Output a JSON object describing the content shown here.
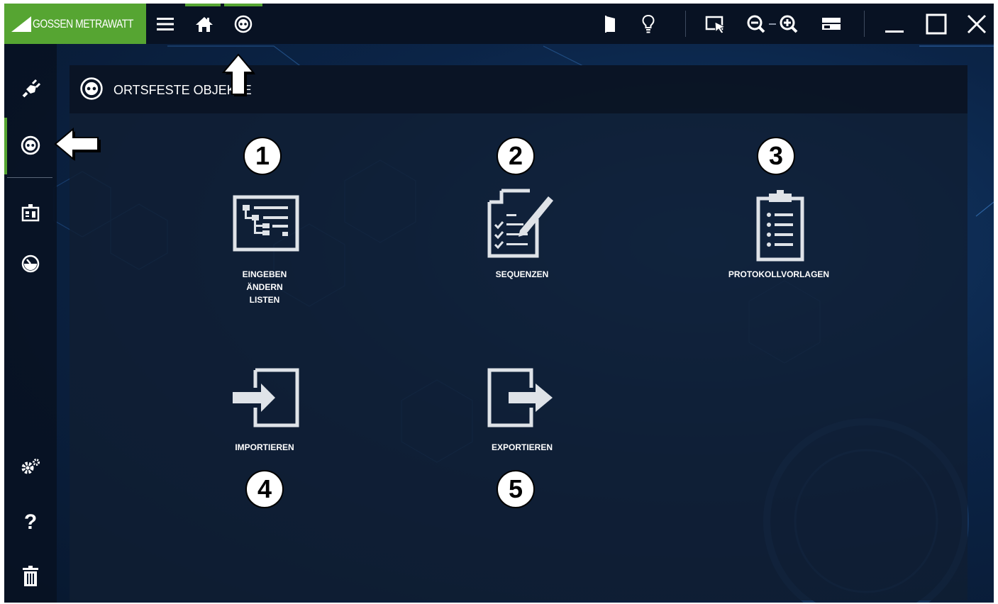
{
  "app": {
    "brand": "GOSSEN METRAWATT",
    "accent_color": "#56a532"
  },
  "titlebar": {
    "left_icons": [
      "menu-icon",
      "home-icon",
      "socket-icon"
    ],
    "right_icons": [
      "door-icon",
      "lightbulb-icon",
      "select-cursor-icon",
      "zoom-out-icon",
      "zoom-in-icon",
      "layout-icon",
      "minimize-icon",
      "maximize-icon",
      "close-icon"
    ]
  },
  "sidebar": {
    "items": [
      "plug-icon",
      "socket-icon",
      "device-id-icon",
      "gauge-icon",
      "settings-icon",
      "help-icon",
      "trash-icon"
    ],
    "help_glyph": "?"
  },
  "panel": {
    "title": "ORTSFESTE OBJEKTE",
    "tiles": [
      {
        "number": "1",
        "label": "EINGEBEN\nÄNDERN\nLISTEN",
        "icon": "tree-list-icon"
      },
      {
        "number": "2",
        "label": "SEQUENZEN",
        "icon": "checklist-edit-icon"
      },
      {
        "number": "3",
        "label": "PROTOKOLLVORLAGEN",
        "icon": "clipboard-list-icon"
      },
      {
        "number": "4",
        "label": "IMPORTIEREN",
        "icon": "import-icon"
      },
      {
        "number": "5",
        "label": "EXPORTIEREN",
        "icon": "export-icon"
      }
    ]
  }
}
